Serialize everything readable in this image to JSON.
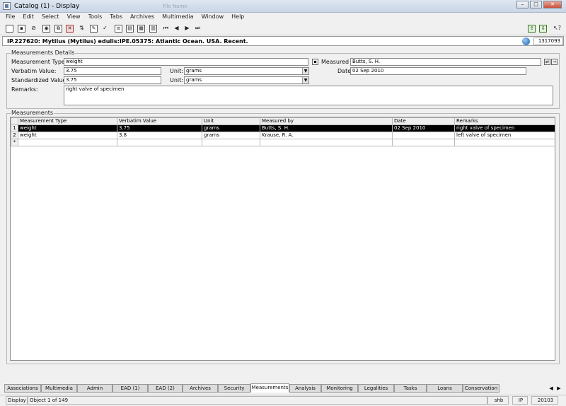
{
  "window": {
    "title": "Catalog (1) - Display",
    "faded_title": "File Name"
  },
  "menu": [
    "File",
    "Edit",
    "Select",
    "View",
    "Tools",
    "Tabs",
    "Archives",
    "Multimedia",
    "Window",
    "Help"
  ],
  "record": {
    "title": "IP.227620: Mytilus (Mytilus) edulis:IPE.05375:  Atlantic Ocean. USA. Recent.",
    "number": "1317093"
  },
  "details": {
    "legend": "Measurements Details",
    "measurement_type_label": "Measurement Type:",
    "measurement_type_value": "weight",
    "measured_by_label": "Measured by:",
    "measured_by_value": "Butts, S. H.",
    "verbatim_label": "Verbatim Value:",
    "verbatim_value": "3.75",
    "unit_label": "Unit:",
    "unit_value": "grams",
    "date_label": "Date:",
    "date_value": "02 Sep 2010",
    "standardized_label": "Standardized Value:",
    "standardized_value": "3.75",
    "unit2_label": "Unit:",
    "unit2_value": "grams",
    "remarks_label": "Remarks:",
    "remarks_value": "right valve of specimen"
  },
  "grid": {
    "legend": "Measurements",
    "columns": [
      "Measurement Type",
      "Verbatim Value",
      "Unit",
      "Measured by",
      "Date",
      "Remarks"
    ],
    "rows": [
      {
        "num": "1",
        "type": "weight",
        "verbatim": "3.75",
        "unit": "grams",
        "by": "Butts, S. H.",
        "date": "02 Sep 2010",
        "remarks": "right valve of specimen"
      },
      {
        "num": "2",
        "type": "weight",
        "verbatim": "3.8",
        "unit": "grams",
        "by": "Krause, R. A.",
        "date": "",
        "remarks": "left valve of specimen"
      }
    ],
    "new_row_marker": "*"
  },
  "tabs": [
    "Associations",
    "Multimedia",
    "Admin",
    "EAD (1)",
    "EAD (2)",
    "Archives",
    "Security",
    "Measurements",
    "Analysis",
    "Monitoring",
    "Legalities",
    "Tasks",
    "Loans",
    "Conservation"
  ],
  "status": {
    "mode": "Display",
    "position": "Object 1 of 149",
    "user": "shb",
    "dept": "IP",
    "code": "20103"
  }
}
